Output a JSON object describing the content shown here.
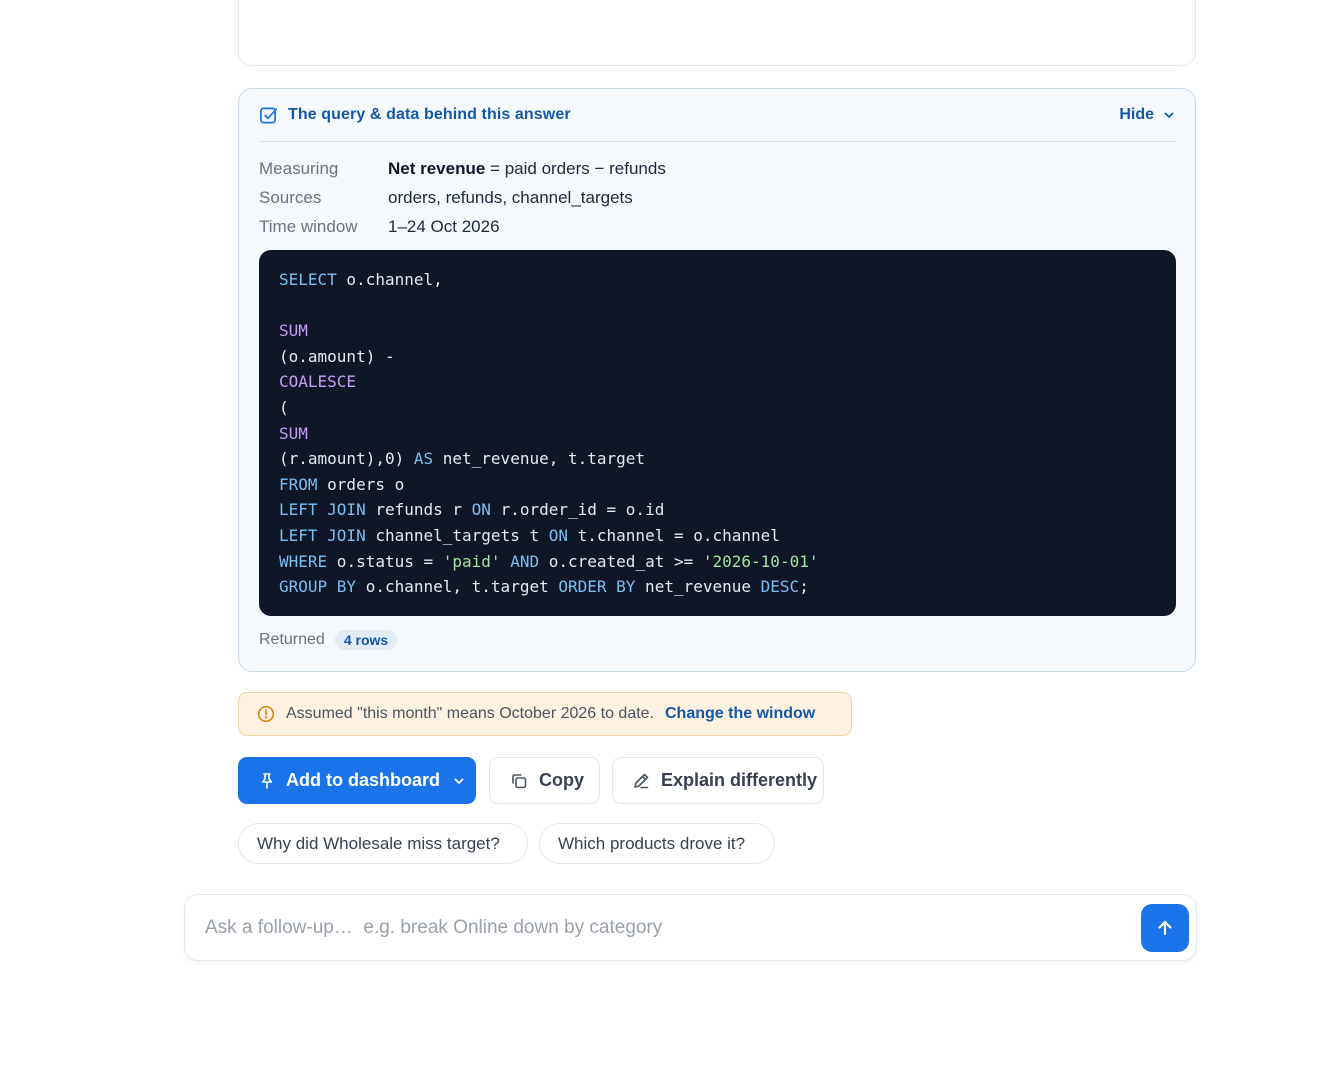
{
  "trace": {
    "title": "The query & data behind this answer",
    "hide_label": "Hide",
    "meta": {
      "measuring_label": "Measuring",
      "measuring_metric": "Net revenue",
      "measuring_formula": " = paid orders − refunds",
      "sources_label": "Sources",
      "sources_value": "orders, refunds, channel_targets",
      "window_label": "Time window",
      "window_value": "1–24 Oct 2026"
    },
    "sql_lines": [
      "SELECT o.channel,",
      "",
      "SUM",
      "(o.amount) -",
      "COALESCE",
      "(",
      "SUM",
      "(r.amount),0) AS net_revenue, t.target",
      "FROM orders o",
      "LEFT JOIN refunds r ON r.order_id = o.id",
      "LEFT JOIN channel_targets t ON t.channel = o.channel",
      "WHERE o.status = 'paid' AND o.created_at >= '2026-10-01'",
      "GROUP BY o.channel, t.target ORDER BY net_revenue DESC;"
    ],
    "returned_label": "Returned",
    "returned_rows": "4 rows"
  },
  "assumption": {
    "text": "Assumed \"this month\" means October 2026 to date.",
    "link": "Change the window"
  },
  "actions": {
    "add_dashboard": "Add to dashboard",
    "copy": "Copy",
    "explain": "Explain differently"
  },
  "suggestions": [
    "Why did Wholesale miss target?",
    "Which products drove it?"
  ],
  "composer": {
    "placeholder": "Ask a follow-up…  e.g. break Online down by category"
  },
  "colors": {
    "accent": "#1a73e8",
    "link": "#1558a8",
    "code_bg": "#0f1727",
    "keyword": "#79bff2",
    "function": "#c89cf5",
    "string": "#9ee6a0",
    "warning_bg": "#fdf1e1"
  },
  "icons": {
    "trace": "checkbox-icon",
    "hide": "chevron-down-icon",
    "assumption": "warning-circle-icon",
    "add": "pin-icon",
    "copy": "copy-icon",
    "explain": "pencil-icon",
    "send": "arrow-up-icon"
  }
}
